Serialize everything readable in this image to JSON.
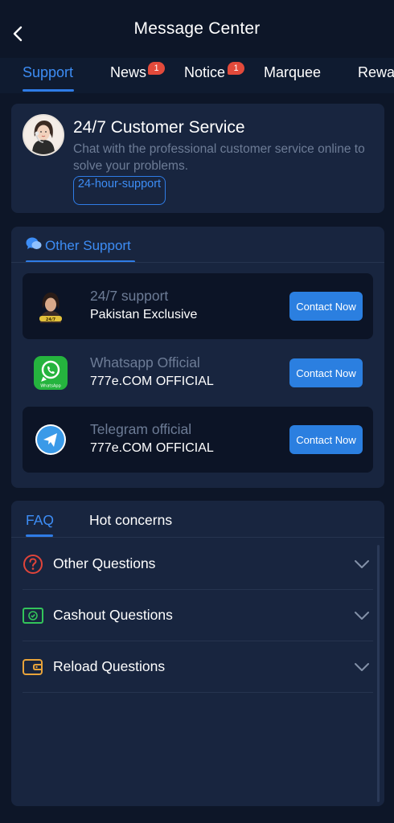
{
  "header": {
    "title": "Message Center"
  },
  "tabs": [
    {
      "label": "Support",
      "badge": null
    },
    {
      "label": "News",
      "badge": "1"
    },
    {
      "label": "Notice",
      "badge": "1"
    },
    {
      "label": "Marquee",
      "badge": null
    },
    {
      "label": "Rewa",
      "badge": null
    }
  ],
  "customer_service": {
    "title": "24/7 Customer Service",
    "description": "Chat with the professional customer service online to solve your problems.",
    "tag": "24-hour-support"
  },
  "other_support": {
    "heading": "Other Support",
    "items": [
      {
        "line1": "24/7 support",
        "line2": "Pakistan Exclusive",
        "button": "Contact Now",
        "icon": "agent-avatar-icon"
      },
      {
        "line1": "Whatsapp Official",
        "line2": "777e.COM OFFICIAL",
        "button": "Contact Now",
        "icon": "whatsapp-icon"
      },
      {
        "line1": "Telegram official",
        "line2": "777e.COM OFFICIAL",
        "button": "Contact Now",
        "icon": "telegram-icon"
      }
    ]
  },
  "faq": {
    "tabs": [
      "FAQ",
      "Hot concerns"
    ],
    "items": [
      {
        "label": "Other Questions",
        "icon": "question-circle-icon",
        "color": "#e0443a"
      },
      {
        "label": "Cashout Questions",
        "icon": "cash-icon",
        "color": "#33c45a"
      },
      {
        "label": "Reload Questions",
        "icon": "wallet-icon",
        "color": "#e8a33a"
      }
    ]
  },
  "colors": {
    "accent": "#3d8df5",
    "background": "#0d1628",
    "card": "#18253f"
  }
}
